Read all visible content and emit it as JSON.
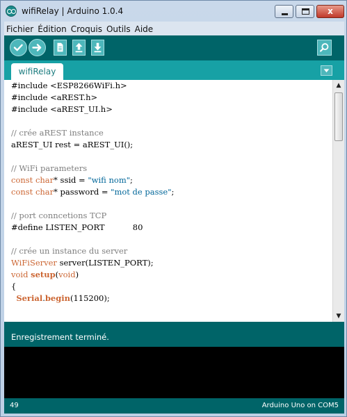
{
  "window": {
    "title": "wifiRelay | Arduino 1.0.4",
    "close_glyph": "x"
  },
  "menu": [
    "Fichier",
    "Édition",
    "Croquis",
    "Outils",
    "Aide"
  ],
  "toolbar": {
    "icons": [
      "verify-icon",
      "upload-icon",
      "new-icon",
      "open-icon",
      "save-icon",
      "serial-monitor-icon"
    ],
    "accent": "#006468",
    "button_color": "#4db7bb"
  },
  "tab": {
    "label": "wifiRelay",
    "tab_bar_color": "#17a1a5"
  },
  "editor": {
    "lines": [
      "#include <ESP8266WiFi.h>",
      "#include <aREST.h>",
      "#include <aREST_UI.h>",
      "",
      "// crée aREST instance",
      "aREST_UI rest = aREST_UI();",
      "",
      "// WiFi parameters",
      "const char* ssid = \"wifi nom\";",
      "const char* password = \"mot de passe\";",
      "",
      "// port conncetions TCP",
      "#define LISTEN_PORT           80",
      "",
      "// crée un instance du server",
      "WiFiServer server(LISTEN_PORT);",
      "void setup(void)",
      "{",
      "  Serial.begin(115200);"
    ]
  },
  "status": {
    "message": "Enregistrement terminé."
  },
  "footer": {
    "line_number": "49",
    "board": "Arduino Uno on COM5"
  }
}
